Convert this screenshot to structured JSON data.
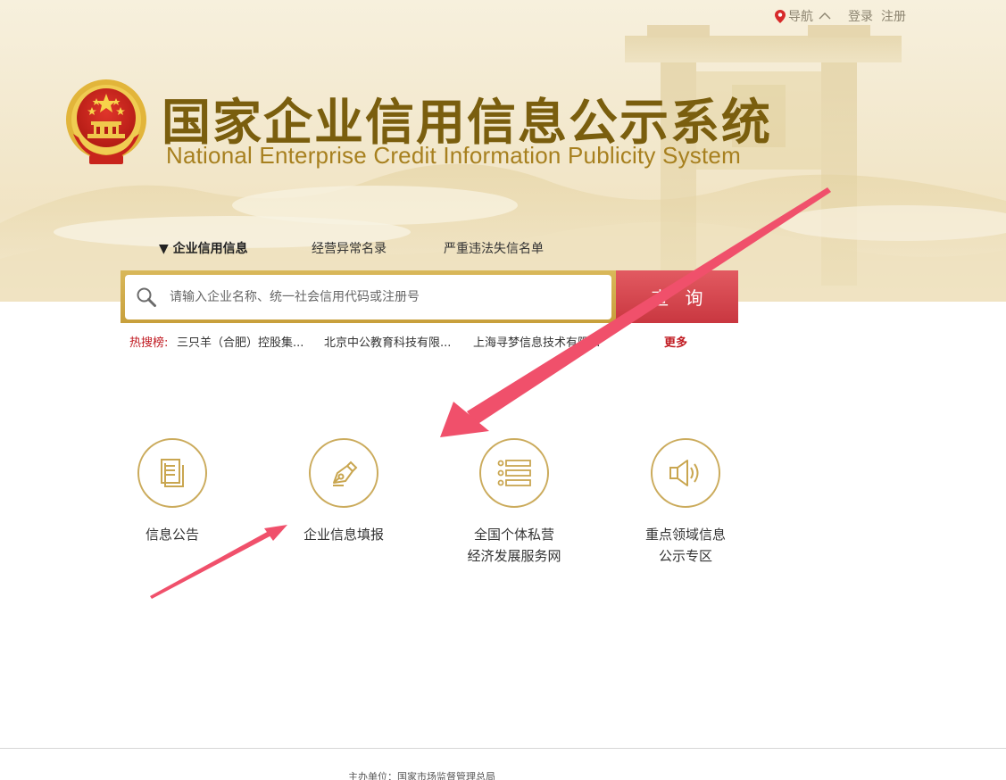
{
  "top_nav": {
    "guide_label": "导航",
    "login_label": "登录",
    "register_label": "注册"
  },
  "header": {
    "title_cn": "国家企业信用信息公示系统",
    "title_en": "National Enterprise Credit Information Publicity System"
  },
  "search": {
    "tabs": [
      {
        "label": "企业信用信息",
        "active": true
      },
      {
        "label": "经营异常名录",
        "active": false
      },
      {
        "label": "严重违法失信名单",
        "active": false
      }
    ],
    "placeholder": "请输入企业名称、统一社会信用代码或注册号",
    "button_label": "查询"
  },
  "hot_search": {
    "label": "热搜榜:",
    "items": [
      "三只羊（合肥）控股集...",
      "北京中公教育科技有限...",
      "上海寻梦信息技术有限..."
    ],
    "more_label": "更多"
  },
  "entries": [
    {
      "label_lines": [
        "信息公告"
      ],
      "icon": "document-icon"
    },
    {
      "label_lines": [
        "企业信息填报"
      ],
      "icon": "pen-nib-icon"
    },
    {
      "label_lines": [
        "全国个体私营",
        "经济发展服务网"
      ],
      "icon": "list-icon"
    },
    {
      "label_lines": [
        "重点领域信息",
        "公示专区"
      ],
      "icon": "speaker-icon"
    }
  ],
  "footer": {
    "sponsor": "主办单位：国家市场监督管理总局"
  },
  "colors": {
    "brand_gold": "#7a5e0e",
    "search_border_gold": "#c8a03c",
    "search_button_red": "#d4474f",
    "hot_red": "#c01920",
    "annotation_arrow": "#f0506b"
  }
}
